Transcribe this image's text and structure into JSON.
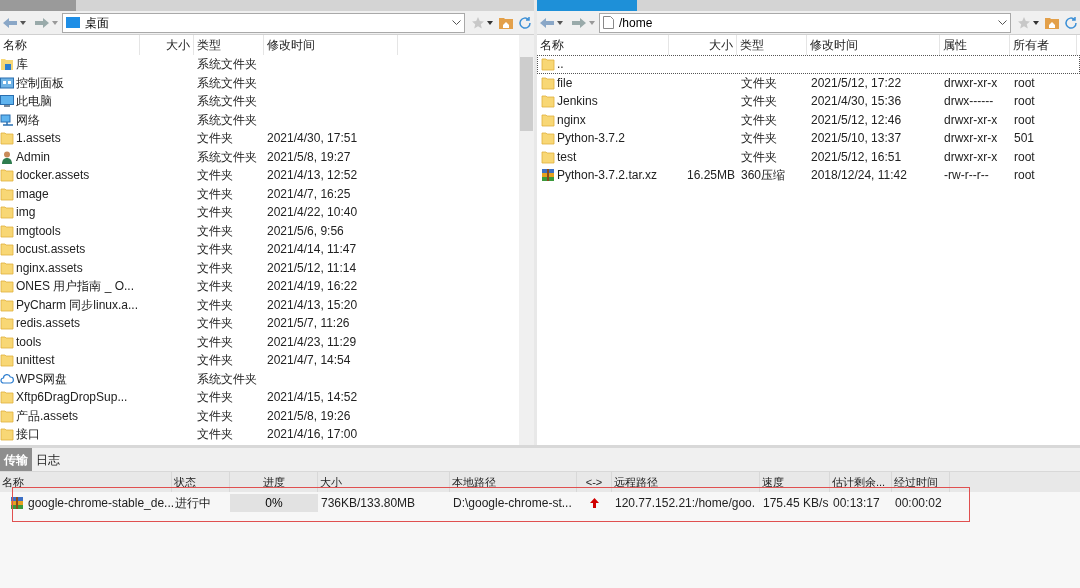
{
  "local_pane": {
    "path": "桌面",
    "columns": [
      "名称",
      "大小",
      "类型",
      "修改时间"
    ],
    "rows": [
      {
        "kind": "library",
        "name": "库",
        "type": "系统文件夹"
      },
      {
        "kind": "control-panel",
        "name": "控制面板",
        "type": "系统文件夹"
      },
      {
        "kind": "computer",
        "name": "此电脑",
        "type": "系统文件夹"
      },
      {
        "kind": "network",
        "name": "网络",
        "type": "系统文件夹"
      },
      {
        "kind": "folder",
        "name": "1.assets",
        "type": "文件夹",
        "modified": "2021/4/30, 17:51"
      },
      {
        "kind": "user",
        "name": "Admin",
        "type": "系统文件夹",
        "modified": "2021/5/8, 19:27"
      },
      {
        "kind": "folder",
        "name": "docker.assets",
        "type": "文件夹",
        "modified": "2021/4/13, 12:52"
      },
      {
        "kind": "folder",
        "name": "image",
        "type": "文件夹",
        "modified": "2021/4/7, 16:25"
      },
      {
        "kind": "folder",
        "name": "img",
        "type": "文件夹",
        "modified": "2021/4/22, 10:40"
      },
      {
        "kind": "folder",
        "name": "imgtools",
        "type": "文件夹",
        "modified": "2021/5/6, 9:56"
      },
      {
        "kind": "folder",
        "name": "locust.assets",
        "type": "文件夹",
        "modified": "2021/4/14, 11:47"
      },
      {
        "kind": "folder",
        "name": "nginx.assets",
        "type": "文件夹",
        "modified": "2021/5/12, 11:14"
      },
      {
        "kind": "folder",
        "name": "ONES 用户指南 _ O...",
        "type": "文件夹",
        "modified": "2021/4/19, 16:22"
      },
      {
        "kind": "folder",
        "name": "PyCharm 同步linux.a...",
        "type": "文件夹",
        "modified": "2021/4/13, 15:20"
      },
      {
        "kind": "folder",
        "name": "redis.assets",
        "type": "文件夹",
        "modified": "2021/5/7, 11:26"
      },
      {
        "kind": "folder",
        "name": "tools",
        "type": "文件夹",
        "modified": "2021/4/23, 11:29"
      },
      {
        "kind": "folder",
        "name": "unittest",
        "type": "文件夹",
        "modified": "2021/4/7, 14:54"
      },
      {
        "kind": "cloud",
        "name": "WPS网盘",
        "type": "系统文件夹"
      },
      {
        "kind": "folder",
        "name": "Xftp6DragDropSup...",
        "type": "文件夹",
        "modified": "2021/4/15, 14:52"
      },
      {
        "kind": "folder",
        "name": "产品.assets",
        "type": "文件夹",
        "modified": "2021/5/8, 19:26"
      },
      {
        "kind": "folder",
        "name": "接口",
        "type": "文件夹",
        "modified": "2021/4/16, 17:00"
      }
    ]
  },
  "remote_pane": {
    "path": "/home",
    "columns": [
      "名称",
      "大小",
      "类型",
      "修改时间",
      "属性",
      "所有者"
    ],
    "rows": [
      {
        "kind": "folder",
        "name": "..",
        "focused": true
      },
      {
        "kind": "folder",
        "name": "file",
        "type": "文件夹",
        "modified": "2021/5/12, 17:22",
        "attributes": "drwxr-xr-x",
        "owner": "root",
        "focused": false
      },
      {
        "kind": "folder",
        "name": "Jenkins",
        "type": "文件夹",
        "modified": "2021/4/30, 15:36",
        "attributes": "drwx------",
        "owner": "root",
        "focused": false
      },
      {
        "kind": "folder",
        "name": "nginx",
        "type": "文件夹",
        "modified": "2021/5/12, 12:46",
        "attributes": "drwxr-xr-x",
        "owner": "root",
        "focused": false
      },
      {
        "kind": "folder",
        "name": "Python-3.7.2",
        "type": "文件夹",
        "modified": "2021/5/10, 13:37",
        "attributes": "drwxr-xr-x",
        "owner": "501",
        "focused": false
      },
      {
        "kind": "folder",
        "name": "test",
        "type": "文件夹",
        "modified": "2021/5/12, 16:51",
        "attributes": "drwxr-xr-x",
        "owner": "root",
        "focused": false
      },
      {
        "kind": "archive",
        "name": "Python-3.7.2.tar.xz",
        "size": "16.25MB",
        "type": "360压缩",
        "modified": "2018/12/24, 11:42",
        "attributes": "-rw-r--r--",
        "owner": "root",
        "focused": false
      }
    ]
  },
  "bottom_tabs": [
    {
      "label": "传输",
      "selected": true
    },
    {
      "label": "日志",
      "selected": false
    }
  ],
  "transfers": {
    "columns": [
      "名称",
      "状态",
      "进度",
      "大小",
      "本地路径",
      "<->",
      "远程路径",
      "速度",
      "估计剩余...",
      "经过时间"
    ],
    "rows": [
      {
        "name": "google-chrome-stable_de...",
        "status": "进行中",
        "progress": "0%",
        "level": 0,
        "size": "736KB/133.80MB",
        "local_path": "D:\\google-chrome-st...",
        "remote_path": "120.77.152.21:/home/goo.",
        "speed": "175.45 KB/s",
        "remaining": "00:13:17",
        "elapsed": "00:00:02"
      }
    ]
  }
}
